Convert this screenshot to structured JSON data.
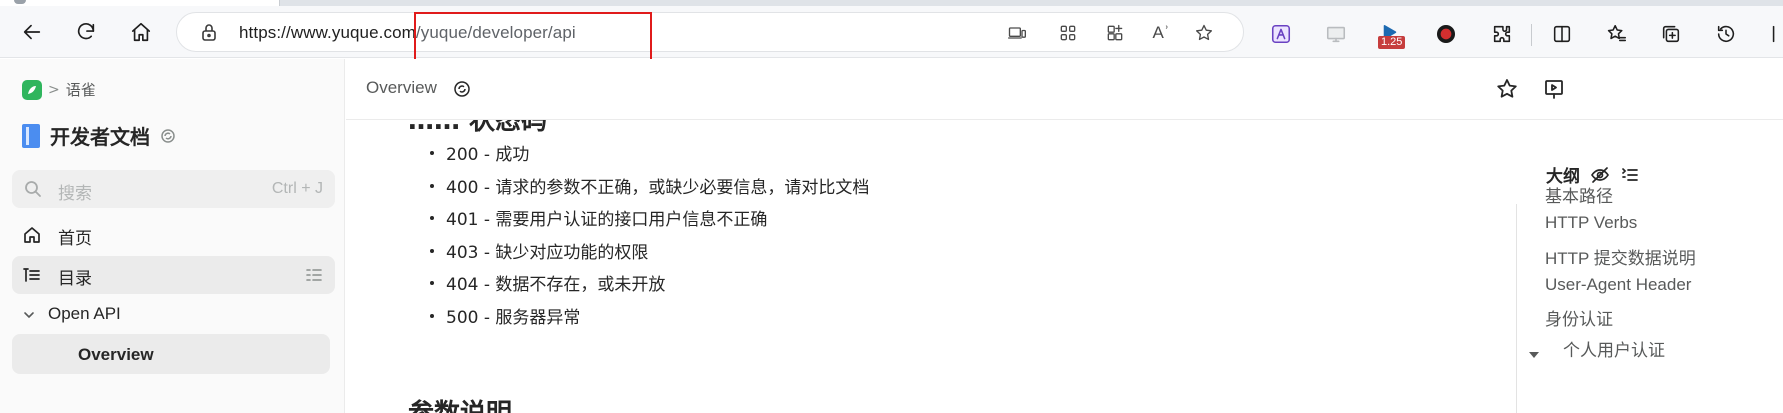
{
  "browser": {
    "url_host": "https://www.yuque.com",
    "url_path": "/yuque/developer/api",
    "omnibox_icons": [
      "device-icon",
      "apps-grid-icon",
      "add-app-icon",
      "read-aloud-icon",
      "favorite-star-icon"
    ],
    "read_aloud_label": "Aʾ",
    "extensions": [
      "translate-extension-icon",
      "screen-capture-extension-icon",
      "speed-extension-icon",
      "record-extension-icon",
      "puzzle-extensions-icon",
      "split-screen-icon",
      "favorites-icon",
      "collections-icon",
      "history-icon"
    ],
    "speed_badge": "1.25",
    "highlight_color": "#e01b1b"
  },
  "sidebar": {
    "breadcrumb": "语雀",
    "book_title": "开发者文档",
    "search": {
      "placeholder": "搜索",
      "shortcut": "Ctrl + J"
    },
    "nav": [
      {
        "label": "首页"
      },
      {
        "label": "目录"
      }
    ],
    "tree": {
      "group": "Open API",
      "active_child": "Overview"
    },
    "accent_color": "#2fb55d"
  },
  "header": {
    "page_crumb": "Overview"
  },
  "content": {
    "cut_heading": "…… 状态码",
    "status_codes": [
      "200 - 成功",
      "400 - 请求的参数不正确，或缺少必要信息，请对比文档",
      "401 - 需要用户认证的接口用户信息不正确",
      "403 - 缺少对应功能的权限",
      "404 - 数据不存在，或未开放",
      "500 - 服务器异常"
    ],
    "next_heading": "参数说明"
  },
  "outline": {
    "title": "大纲",
    "items": [
      {
        "label": "基本路径",
        "latin": false
      },
      {
        "label": "HTTP Verbs",
        "latin": true
      },
      {
        "label": "HTTP 提交数据说明",
        "latin": true
      },
      {
        "label": "User-Agent Header",
        "latin": true
      },
      {
        "label": "身份认证",
        "latin": false
      },
      {
        "label": "个人用户认证",
        "latin": false
      }
    ]
  }
}
